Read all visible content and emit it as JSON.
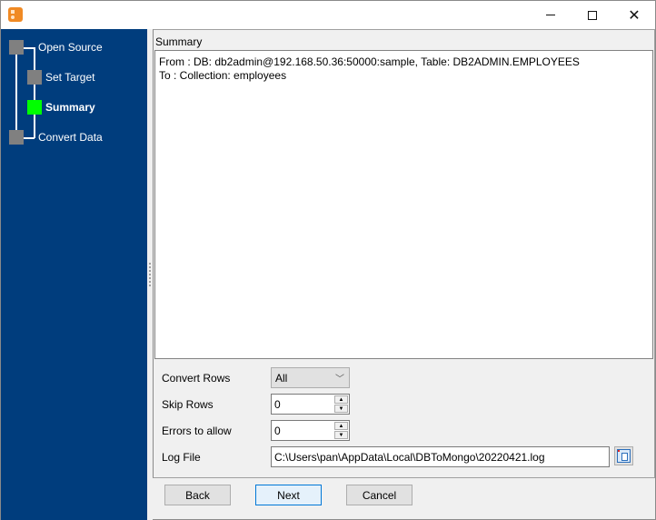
{
  "window": {
    "app_icon": "app-logo-icon",
    "controls": {
      "minimize": "minimize-icon",
      "maximize": "maximize-icon",
      "close": "close-icon",
      "close_glyph": "✕"
    }
  },
  "wizard": {
    "steps": [
      {
        "label": "Open Source",
        "status": "pending"
      },
      {
        "label": "Set Target",
        "status": "pending"
      },
      {
        "label": "Summary",
        "status": "active"
      },
      {
        "label": "Convert Data",
        "status": "pending"
      }
    ],
    "colors": {
      "sidebar_bg": "#003d7d",
      "node_pending": "#808080",
      "node_active": "#00ff00"
    }
  },
  "summary": {
    "title": "Summary",
    "lines": [
      "From : DB: db2admin@192.168.50.36:50000:sample, Table: DB2ADMIN.EMPLOYEES",
      "To : Collection: employees"
    ]
  },
  "options": {
    "convert_rows": {
      "label": "Convert Rows",
      "value": "All"
    },
    "skip_rows": {
      "label": "Skip Rows",
      "value": "0"
    },
    "errors_to_allow": {
      "label": "Errors to allow",
      "value": "0"
    },
    "log_file": {
      "label": "Log File",
      "value": "C:\\Users\\pan\\AppData\\Local\\DBToMongo\\20220421.log"
    }
  },
  "buttons": {
    "back": "Back",
    "next": "Next",
    "cancel": "Cancel"
  },
  "glyphs": {
    "chevron_down": "﹀",
    "up": "▲",
    "down": "▼"
  }
}
